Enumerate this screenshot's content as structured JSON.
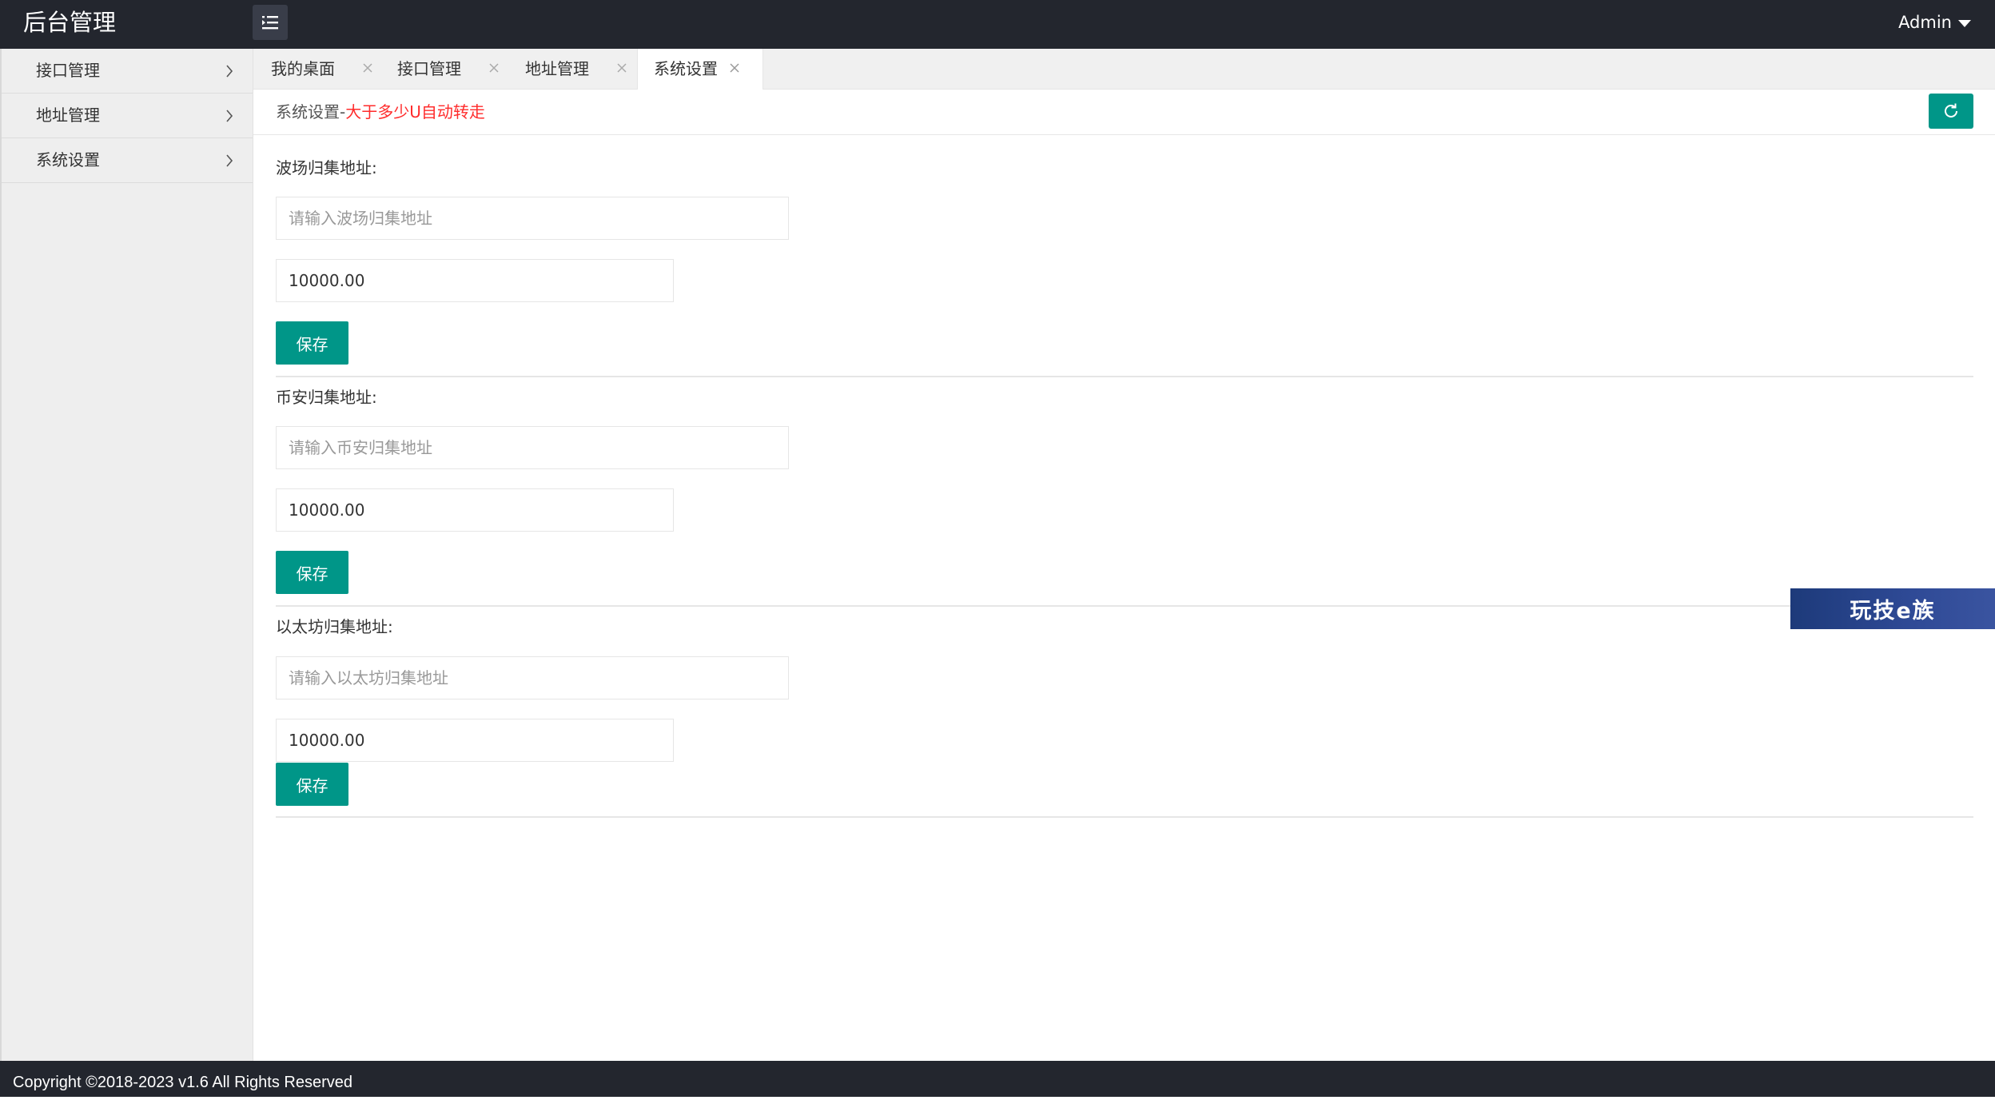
{
  "header": {
    "brand": "后台管理",
    "user": "Admin"
  },
  "sidebar": {
    "items": [
      {
        "label": "接口管理"
      },
      {
        "label": "地址管理"
      },
      {
        "label": "系统设置"
      }
    ]
  },
  "tabs": [
    {
      "label": "我的桌面",
      "active": false
    },
    {
      "label": "接口管理",
      "active": false
    },
    {
      "label": "地址管理",
      "active": false
    },
    {
      "label": "系统设置",
      "active": true
    }
  ],
  "page": {
    "title_prefix": "系统设置-",
    "title_highlight": "大于多少U自动转走"
  },
  "sections": [
    {
      "label": "波场归集地址:",
      "address_placeholder": "请输入波场归集地址",
      "amount": "10000.00",
      "save_label": "保存"
    },
    {
      "label": "币安归集地址:",
      "address_placeholder": "请输入币安归集地址",
      "amount": "10000.00",
      "save_label": "保存"
    },
    {
      "label": "以太坊归集地址:",
      "address_placeholder": "请输入以太坊归集地址",
      "amount": "10000.00",
      "save_label": "保存"
    }
  ],
  "badge": {
    "text": "玩技e族"
  },
  "footer": {
    "text": "Copyright ©2018-2023 v1.6 All Rights Reserved"
  },
  "colors": {
    "header_bg": "#23262e",
    "accent": "#009688",
    "highlight": "#ff2b2b"
  }
}
